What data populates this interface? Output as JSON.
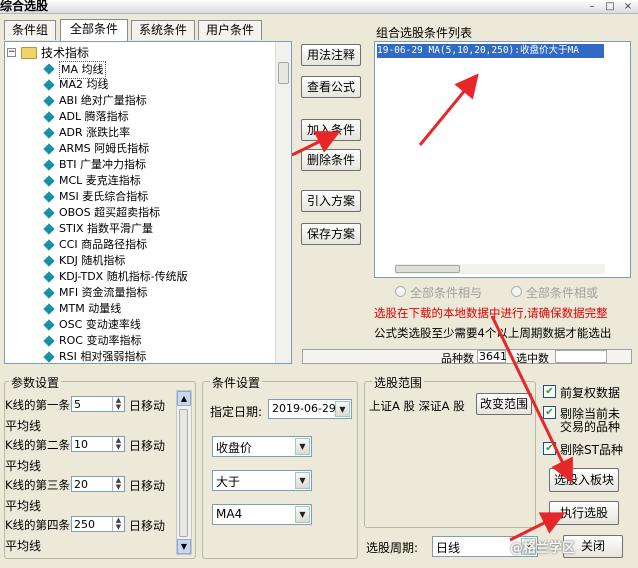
{
  "window": {
    "title": "综合选股",
    "buttons": [
      "–",
      "□",
      "×"
    ]
  },
  "tabs": [
    "条件组",
    "全部条件",
    "系统条件",
    "用户条件"
  ],
  "tree": {
    "root": "技术指标",
    "items": [
      "MA 均线",
      "MA2 均线",
      "ABI 绝对广量指标",
      "ADL 腾落指标",
      "ADR 涨跌比率",
      "ARMS 阿姆氏指标",
      "BTI 广量冲力指标",
      "MCL 麦克连指标",
      "MSI 麦氏综合指标",
      "OBOS 超买超卖指标",
      "STIX 指数平滑广量",
      "CCI 商品路径指标",
      "KDJ 随机指标",
      "KDJ-TDX 随机指标-传统版",
      "MFI 资金流量指标",
      "MTM 动量线",
      "OSC 变动速率线",
      "ROC 变动率指标",
      "RSI 相对强弱指标"
    ]
  },
  "mid_buttons": [
    "用法注释",
    "查看公式",
    "加入条件",
    "删除条件",
    "引入方案",
    "保存方案"
  ],
  "condition_list": {
    "label": "组合选股条件列表",
    "items": [
      "19-06-29 MA(5,10,20,250):收盘价大于MA"
    ]
  },
  "logic": {
    "and_label": "全部条件相与",
    "or_label": "全部条件相或"
  },
  "notes": {
    "warning": "选股在下载的本地数据中进行,请确保数据完整",
    "info": "公式类选股至少需要4个以上周期数据才能选出"
  },
  "stats": {
    "count_label": "品种数",
    "count_value": "3641",
    "selected_label": "选中数",
    "selected_value": ""
  },
  "params": {
    "title": "参数设置",
    "rows": [
      {
        "prefix": "K线的第一条",
        "value": "5",
        "suffix": "日移动",
        "tail": "平均线"
      },
      {
        "prefix": "K线的第二条",
        "value": "10",
        "suffix": "日移动",
        "tail": "平均线"
      },
      {
        "prefix": "K线的第三条",
        "value": "20",
        "suffix": "日移动",
        "tail": "平均线"
      },
      {
        "prefix": "K线的第四条",
        "value": "250",
        "suffix": "日移动",
        "tail": "平均线"
      }
    ]
  },
  "cond_settings": {
    "title": "条件设置",
    "date_label": "指定日期:",
    "date_value": "2019-06-29",
    "field": "收盘价",
    "operator": "大于",
    "target": "MA4"
  },
  "scope": {
    "title": "选股范围",
    "markets": "上证A 股  深证A 股",
    "change_button": "改变范围"
  },
  "options": [
    {
      "label": "前复权数据",
      "checked": true
    },
    {
      "label": "剔除当前未",
      "label2": "交易的品种",
      "checked": true
    },
    {
      "label": "剔除ST品种",
      "checked": true
    }
  ],
  "actions": {
    "to_block": "选股入板块",
    "run": "执行选股",
    "close": "关闭"
  },
  "period": {
    "label": "选股周期:",
    "value": "日线"
  },
  "watermark": "@格兰学区"
}
